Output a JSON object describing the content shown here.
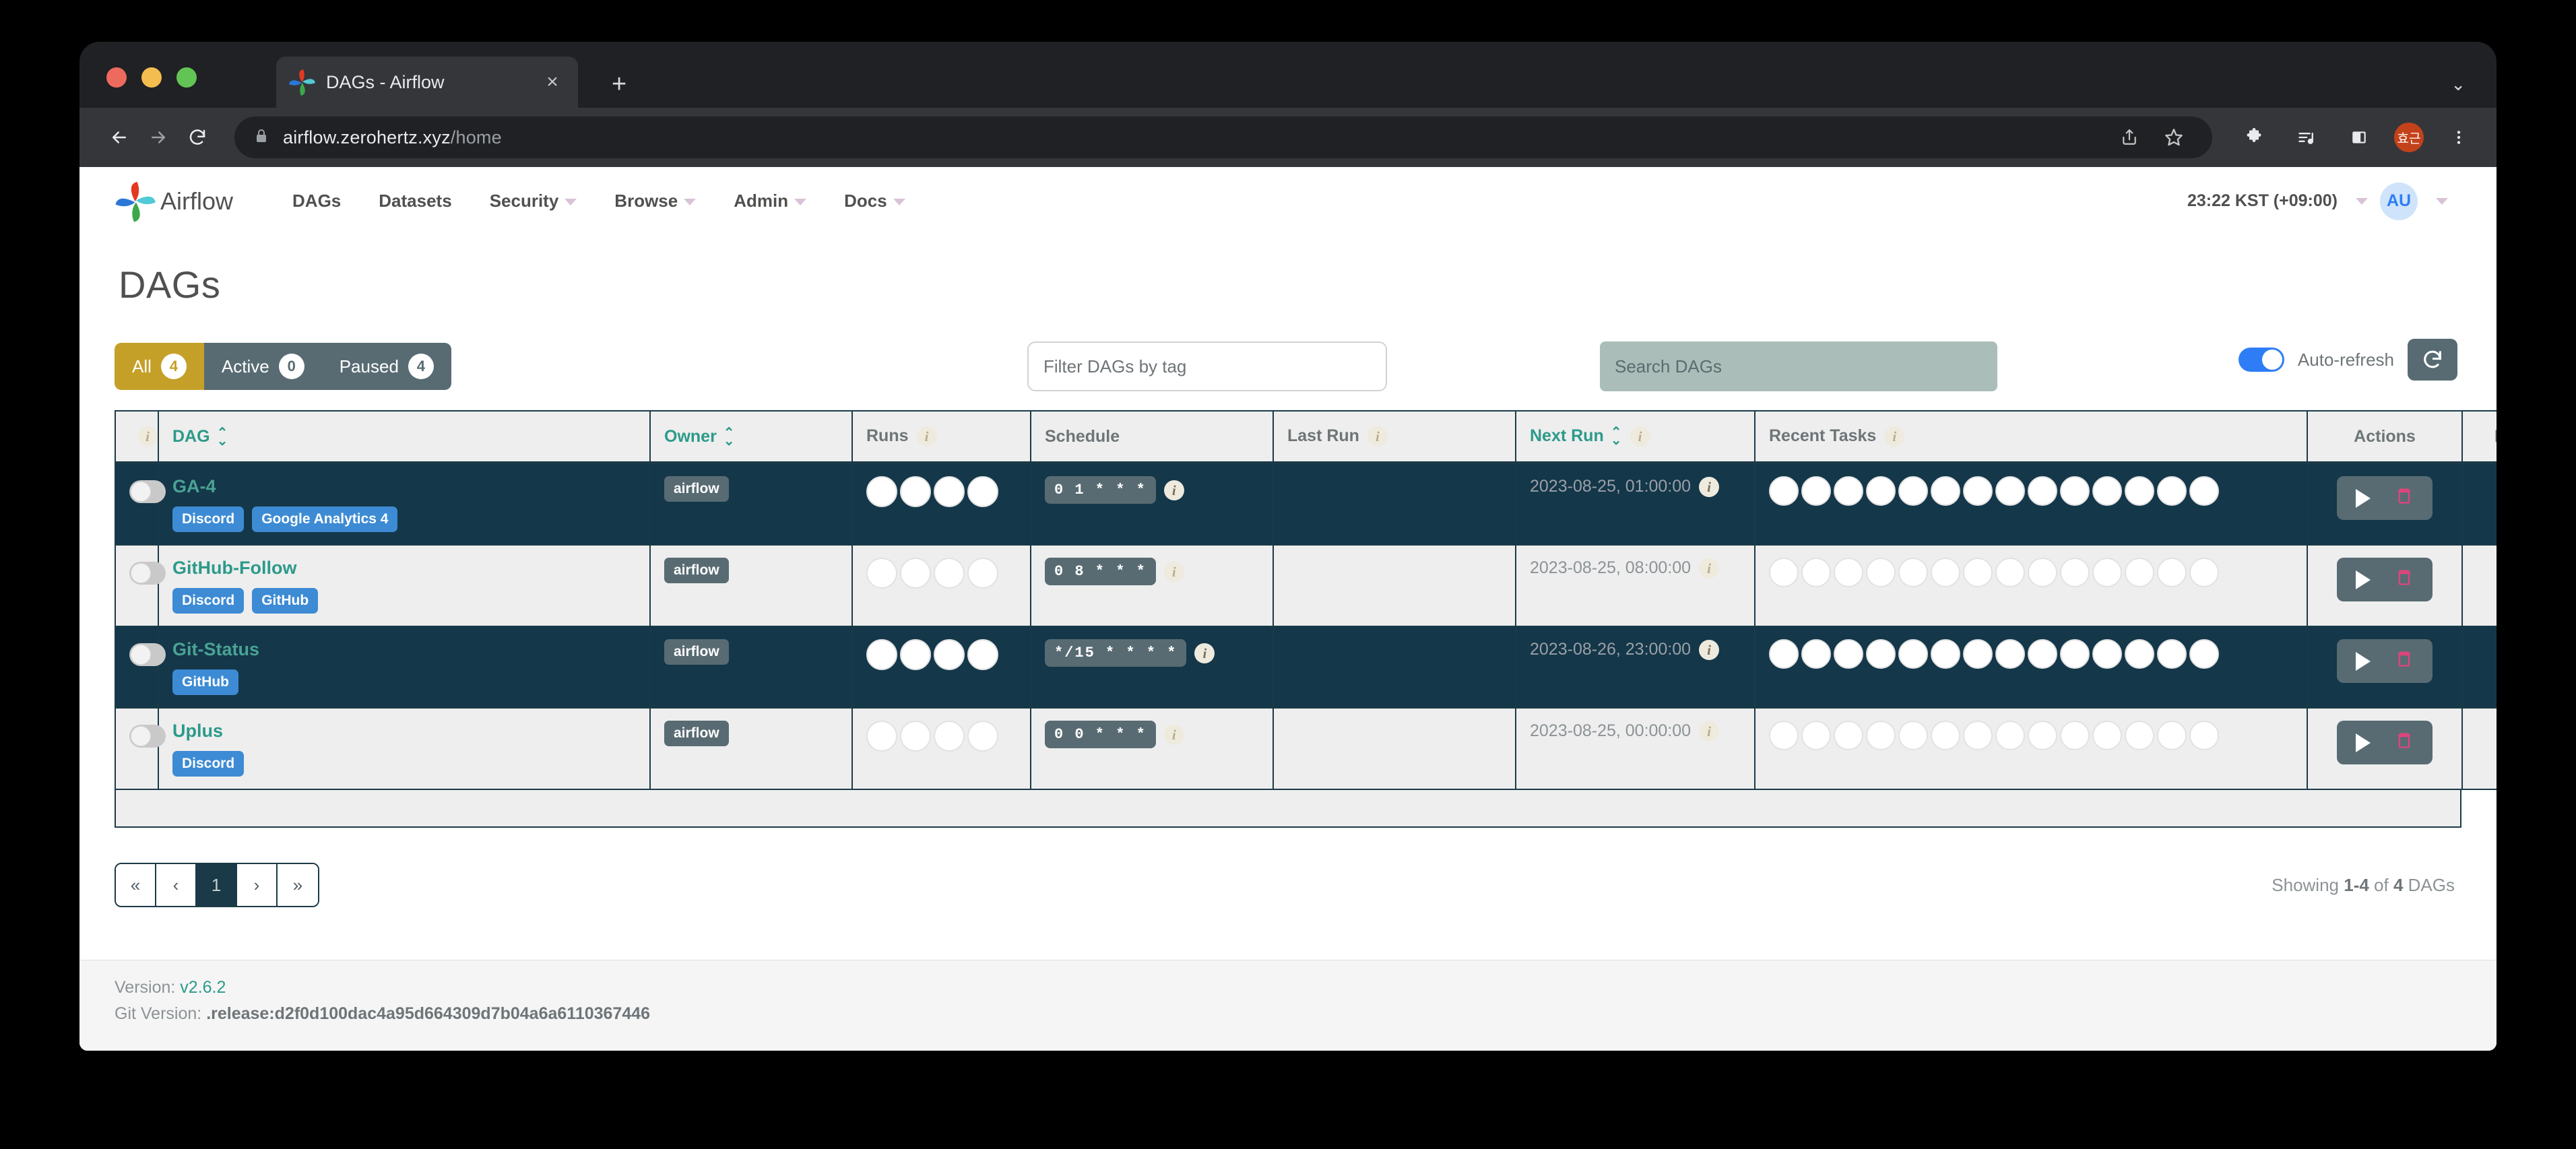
{
  "browser": {
    "tab_title": "DAGs - Airflow",
    "tab_close_icon": "close-icon",
    "new_tab_icon": "plus-icon",
    "back_icon": "back-arrow-icon",
    "forward_icon": "forward-arrow-icon",
    "reload_icon": "reload-icon",
    "lock_icon": "lock-icon",
    "url_host": "airflow.zerohertz.xyz",
    "url_path": "/home",
    "share_icon": "share-icon",
    "bookmark_icon": "star-icon",
    "extensions_icon": "puzzle-icon",
    "media_icon": "media-list-icon",
    "sidepanel_icon": "side-panel-icon",
    "profile_initials": "효근",
    "menu_icon": "three-dot-menu-icon",
    "window_collapse_icon": "chevron-down-icon"
  },
  "airflow_nav": {
    "brand": "Airflow",
    "links": [
      {
        "label": "DAGs",
        "has_caret": false
      },
      {
        "label": "Datasets",
        "has_caret": false
      },
      {
        "label": "Security",
        "has_caret": true
      },
      {
        "label": "Browse",
        "has_caret": true
      },
      {
        "label": "Admin",
        "has_caret": true
      },
      {
        "label": "Docs",
        "has_caret": true
      }
    ],
    "timezone": "23:22 KST (+09:00)",
    "avatar_initials": "AU"
  },
  "page": {
    "title": "DAGs"
  },
  "filters": {
    "segments": [
      {
        "label": "All",
        "count": "4",
        "active": true
      },
      {
        "label": "Active",
        "count": "0",
        "active": false
      },
      {
        "label": "Paused",
        "count": "4",
        "active": false
      }
    ],
    "tag_placeholder": "Filter DAGs by tag",
    "tag_value": "",
    "search_placeholder": "Search DAGs",
    "search_value": "",
    "auto_refresh_label": "Auto-refresh",
    "auto_refresh_on": true,
    "refresh_icon": "refresh-icon"
  },
  "table": {
    "headers": [
      {
        "label": "",
        "link": false,
        "sort": false,
        "hint": true
      },
      {
        "label": "DAG",
        "link": true,
        "sort": true,
        "hint": false
      },
      {
        "label": "Owner",
        "link": true,
        "sort": true,
        "hint": false
      },
      {
        "label": "Runs",
        "link": false,
        "sort": false,
        "hint": true
      },
      {
        "label": "Schedule",
        "link": false,
        "sort": false,
        "hint": false
      },
      {
        "label": "Last Run",
        "link": false,
        "sort": false,
        "hint": true
      },
      {
        "label": "Next Run",
        "link": true,
        "sort": true,
        "hint": true
      },
      {
        "label": "Recent Tasks",
        "link": false,
        "sort": false,
        "hint": true
      },
      {
        "label": "Actions",
        "link": false,
        "sort": false,
        "hint": false
      },
      {
        "label": "Links",
        "link": false,
        "sort": false,
        "hint": false
      }
    ],
    "runs_circle_count": 4,
    "tasks_circle_count": 14,
    "rows": [
      {
        "name": "GA-4",
        "paused": true,
        "tags": [
          "Discord",
          "Google Analytics 4"
        ],
        "owner": "airflow",
        "schedule": "0 1 * * *",
        "last_run": "",
        "next_run": "2023-08-25, 01:00:00",
        "highlight": true
      },
      {
        "name": "GitHub-Follow",
        "paused": true,
        "tags": [
          "Discord",
          "GitHub"
        ],
        "owner": "airflow",
        "schedule": "0 8 * * *",
        "last_run": "",
        "next_run": "2023-08-25, 08:00:00",
        "highlight": false
      },
      {
        "name": "Git-Status",
        "paused": true,
        "tags": [
          "GitHub"
        ],
        "owner": "airflow",
        "schedule": "*/15 * * * *",
        "last_run": "",
        "next_run": "2023-08-26, 23:00:00",
        "highlight": true
      },
      {
        "name": "Uplus",
        "paused": true,
        "tags": [
          "Discord"
        ],
        "owner": "airflow",
        "schedule": "0 0 * * *",
        "last_run": "",
        "next_run": "2023-08-25, 00:00:00",
        "highlight": false
      }
    ],
    "action_play_icon": "play-icon",
    "action_delete_icon": "trash-icon",
    "links_icon": "ellipsis-icon"
  },
  "pagination": {
    "first": "«",
    "prev": "‹",
    "pages": [
      "1"
    ],
    "next": "›",
    "last": "»",
    "showing_prefix": "Showing ",
    "showing_range": "1-4",
    "showing_mid": " of ",
    "showing_total": "4",
    "showing_suffix": " DAGs"
  },
  "footer": {
    "version_label": "Version:",
    "version_value": "v2.6.2",
    "git_label": "Git Version:",
    "git_value": ".release:d2f0d100dac4a95d664309d7b04a6a6110367446"
  }
}
